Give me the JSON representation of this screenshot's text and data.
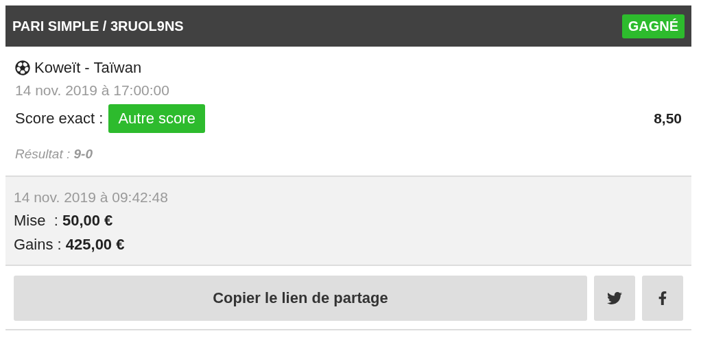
{
  "header": {
    "title": "PARI SIMPLE / 3RUOL9NS",
    "status": {
      "label": "GAGNÉ",
      "kind": "won"
    }
  },
  "event": {
    "match": "Koweït - Taïwan",
    "date": "14 nov. 2019 à 17:00:00",
    "market": "Score exact :",
    "selection": "Autre score",
    "odds": "8,50",
    "result": "Résultat : **9-0**"
  },
  "summary": {
    "date": "14 nov. 2019 à 09:42:48",
    "stake": "Mise  : **50,00 €**",
    "winnings": "Gains : **425,00 €**"
  },
  "actions": [
    {
      "kind": "copy",
      "label": "Copier le lien de partage"
    },
    {
      "kind": "twitter"
    },
    {
      "kind": "facebook"
    }
  ]
}
